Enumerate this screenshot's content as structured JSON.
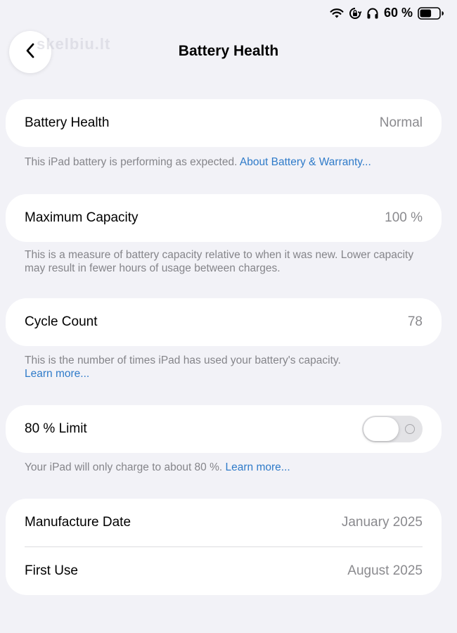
{
  "status_bar": {
    "battery_percent_text": "60 %",
    "battery_level": 0.6,
    "icons": [
      "wifi-icon",
      "orientation-lock-icon",
      "headphones-icon",
      "battery-icon"
    ]
  },
  "nav": {
    "title": "Battery Health",
    "back_icon": "chevron-left-icon",
    "watermark": "skelbiu.lt"
  },
  "battery_health": {
    "label": "Battery Health",
    "value": "Normal",
    "footer_text": "This iPad battery is performing as expected. ",
    "footer_link": "About Battery & Warranty..."
  },
  "maximum_capacity": {
    "label": "Maximum Capacity",
    "value": "100 %",
    "footer_text": "This is a measure of battery capacity relative to when it was new. Lower capacity may result in fewer hours of usage between charges."
  },
  "cycle_count": {
    "label": "Cycle Count",
    "value": "78",
    "footer_text": "This is the number of times iPad has used your battery's capacity.",
    "footer_link": "Learn more..."
  },
  "limit": {
    "label": "80 % Limit",
    "enabled": false,
    "footer_text": "Your iPad will only charge to about 80 %. ",
    "footer_link": "Learn more..."
  },
  "dates": {
    "manufacture_label": "Manufacture Date",
    "manufacture_value": "January 2025",
    "first_use_label": "First Use",
    "first_use_value": "August 2025"
  },
  "colors": {
    "background": "#f2f2f7",
    "card": "#ffffff",
    "link": "#2f7bc9",
    "secondary_text": "#8a8a8e"
  }
}
